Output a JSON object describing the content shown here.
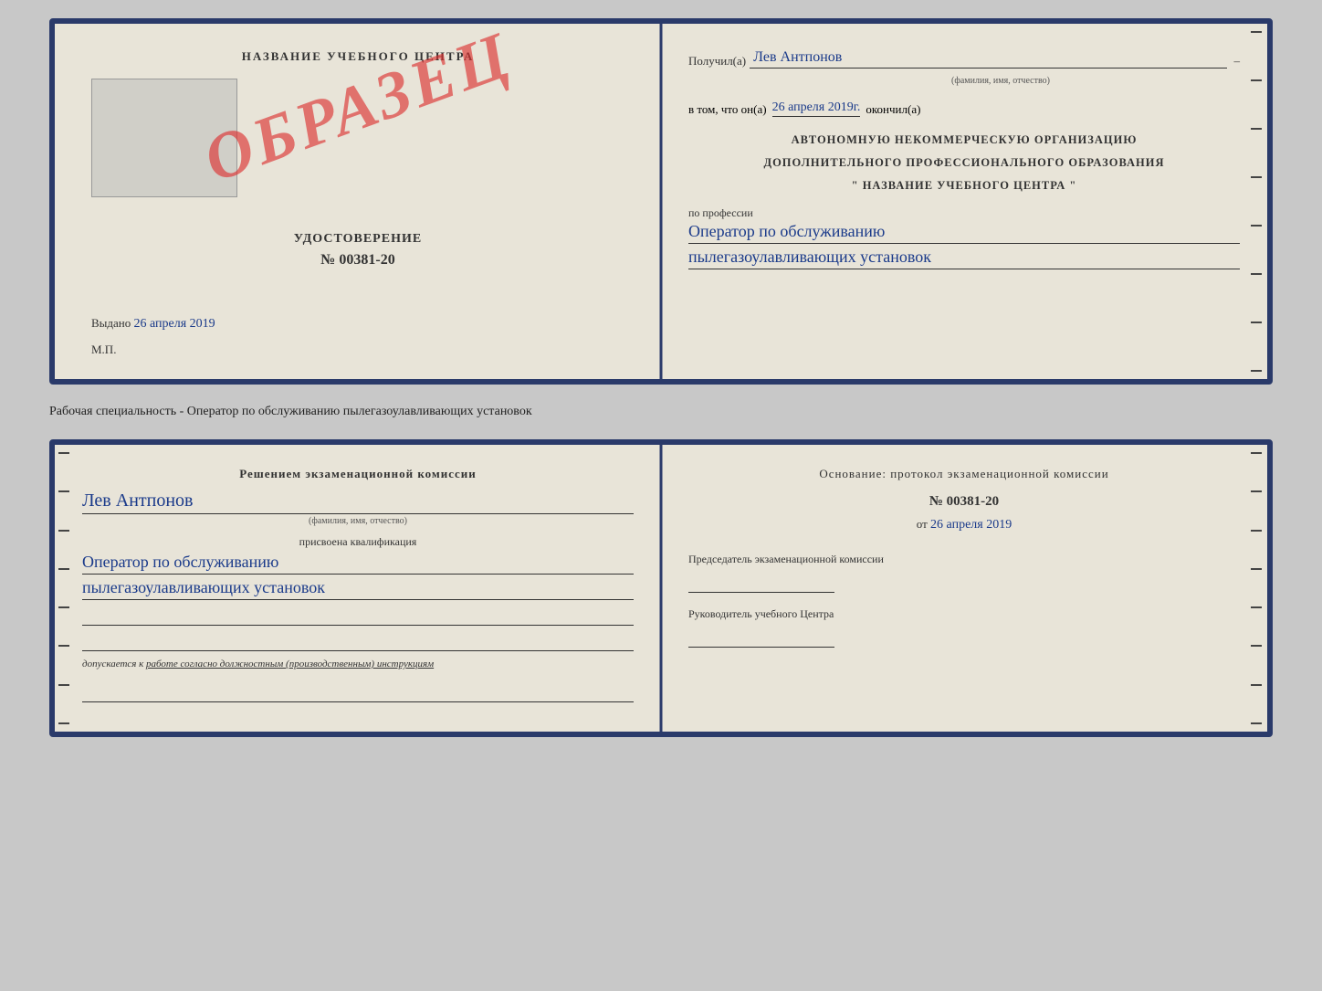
{
  "top": {
    "left": {
      "header": "НАЗВАНИЕ УЧЕБНОГО ЦЕНТРА",
      "stamp_text": "ОБРАЗЕЦ",
      "cert_title": "УДОСТОВЕРЕНИЕ",
      "cert_number": "№ 00381-20",
      "vydano": "Выдано",
      "vydano_date": "26 апреля 2019",
      "mp": "М.П."
    },
    "right": {
      "poluchil_label": "Получил(a)",
      "recipient_name": "Лев Антпонов",
      "fio_subtext": "(фамилия, имя, отчество)",
      "vtom_prefix": "в том, что он(а)",
      "vtom_date": "26 апреля 2019г.",
      "okonchil": "окончил(а)",
      "org_line1": "АВТОНОМНУЮ НЕКОММЕРЧЕСКУЮ ОРГАНИЗАЦИЮ",
      "org_line2": "ДОПОЛНИТЕЛЬНОГО ПРОФЕССИОНАЛЬНОГО ОБРАЗОВАНИЯ",
      "org_quote": "\" НАЗВАНИЕ УЧЕБНОГО ЦЕНТРА \"",
      "profession_label": "по профессии",
      "profession_line1": "Оператор по обслуживанию",
      "profession_line2": "пылегазоулавливающих установок"
    }
  },
  "between_label": "Рабочая специальность - Оператор по обслуживанию пылегазоулавливающих установок",
  "bottom": {
    "left": {
      "title_line1": "Решением экзаменационной комиссии",
      "name": "Лев Антпонов",
      "fio_subtext": "(фамилия, имя, отчество)",
      "prisvoena": "присвоена квалификация",
      "qualification_line1": "Оператор по обслуживанию",
      "qualification_line2": "пылегазоулавливающих установок",
      "dopuskaetsya_prefix": "допускается к",
      "dopuskaetsya_text": "работе согласно должностным (производственным) инструкциям"
    },
    "right": {
      "osnovanie_label": "Основание: протокол экзаменационной комиссии",
      "protocol_number": "№ 00381-20",
      "from_prefix": "от",
      "from_date": "26 апреля 2019",
      "chairman_label": "Председатель экзаменационной комиссии",
      "center_head_label": "Руководитель учебного Центра"
    }
  }
}
